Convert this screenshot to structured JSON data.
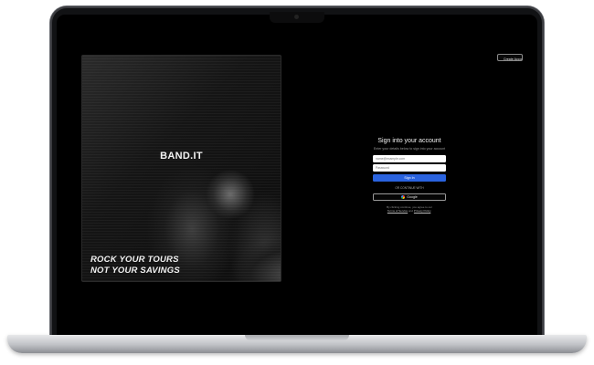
{
  "header": {
    "create_account_label": "Create Account"
  },
  "hero": {
    "brand": "BAND.IT",
    "tagline_line1": "ROCK YOUR TOURS",
    "tagline_line2": "NOT YOUR SAVINGS"
  },
  "signin": {
    "title": "Sign into your account",
    "subtitle": "Enter your details below to sign into your account",
    "email_placeholder": "name@example.com",
    "password_placeholder": "Password",
    "submit_label": "Sign In",
    "divider_text": "OR CONTINUE WITH",
    "google_label": "Google",
    "terms_prefix": "By clicking continue, you agree to our",
    "terms_link": "Terms of Service",
    "terms_and": "and",
    "privacy_link": "Privacy Policy",
    "terms_suffix": "."
  },
  "icons": {
    "google": "google-icon",
    "camera": "camera-icon"
  }
}
